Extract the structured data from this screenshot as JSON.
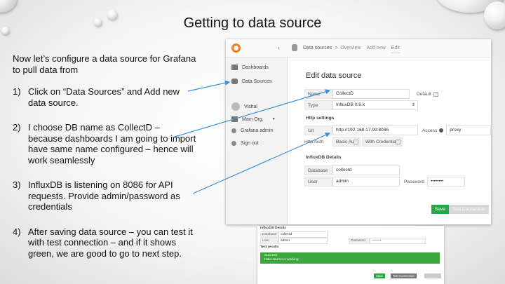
{
  "slide": {
    "title": "Getting to data source",
    "intro": "Now let’s configure a data source for Grafana to pull data from",
    "steps": [
      {
        "num": "1)",
        "text": "Click on “Data Sources” and Add new data source."
      },
      {
        "num": "2)",
        "text": "I choose DB name as CollectD – because dashboards I am going to import have same name configured – hence will work seamlessly"
      },
      {
        "num": "3)",
        "text": "InfluxDB is listening on 8086 for API requests. Provide admin/password as credentials"
      },
      {
        "num": "4)",
        "text": "After saving data source – you can test it with test connection – and if it shows green, we are good to go to next step."
      }
    ]
  },
  "grafana": {
    "breadcrumb": {
      "section": "Data sources",
      "sep": ">",
      "overview": "Overview",
      "add_new": "Add new",
      "edit": "Edit"
    },
    "sidebar": {
      "dashboards": "Dashboards",
      "data_sources": "Data Sources",
      "user": "Vishal",
      "org": "Main Org.",
      "admin": "Grafana admin",
      "signout": "Sign out"
    },
    "heading": "Edit data source",
    "name_label": "Name",
    "name_value": "CollectD",
    "default_label": "Default",
    "type_label": "Type",
    "type_value": "InfluxDB 0.9.x",
    "http_heading": "Http settings",
    "url_label": "Url",
    "url_value": "http://192.168.17.99:8086",
    "access_label": "Access",
    "access_value": "proxy",
    "http_auth_label": "Http Auth",
    "basic_auth_label": "Basic Auth",
    "with_credentials_label": "With Credentials",
    "influx_heading": "InfluxDB Details",
    "database_label": "Database",
    "database_value": "collectd",
    "user_label": "User",
    "user_value": "admin",
    "password_label": "Password",
    "password_value": "••••••••",
    "save_label": "Save",
    "test_label": "Test Connection",
    "accent_green": "#28a745",
    "accent_orange": "#f47b20"
  },
  "grafana2": {
    "heading": "InfluxDB Details",
    "database_label": "Database",
    "database_value": "collectd",
    "user_label": "User",
    "user_value": "admin",
    "password_label": "Password",
    "password_value": "••••••••",
    "results_heading": "Test results",
    "success_title": "Success",
    "success_text": "Data source is working",
    "save_label": "Save",
    "test_label": "Test Connection"
  }
}
